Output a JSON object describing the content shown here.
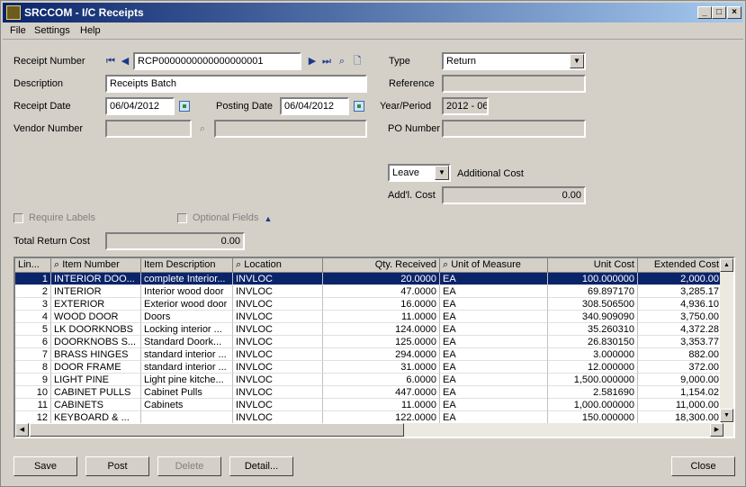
{
  "window": {
    "title": "SRCCOM - I/C Receipts"
  },
  "menu": [
    "File",
    "Settings",
    "Help"
  ],
  "form": {
    "receipt_number_label": "Receipt Number",
    "receipt_number": "RCP0000000000000000001",
    "description_label": "Description",
    "description": "Receipts Batch",
    "receipt_date_label": "Receipt Date",
    "receipt_date": "06/04/2012",
    "posting_date_label": "Posting Date",
    "posting_date": "06/04/2012",
    "vendor_number_label": "Vendor Number",
    "vendor_number": "",
    "vendor_name": "",
    "type_label": "Type",
    "type_value": "Return",
    "reference_label": "Reference",
    "reference": "",
    "year_period_label": "Year/Period",
    "year_period": "2012 - 06",
    "po_number_label": "PO Number",
    "po_number": "",
    "additional_cost_select": "Leave",
    "additional_cost_label": "Additional Cost",
    "addl_cost_label": "Add'l. Cost",
    "addl_cost": "0.00",
    "require_labels": "Require Labels",
    "optional_fields": "Optional Fields",
    "total_return_cost_label": "Total Return Cost",
    "total_return_cost": "0.00"
  },
  "grid": {
    "columns": [
      "Lin...",
      "Item Number",
      "Item Description",
      "Location",
      "Qty. Received",
      "Unit of Measure",
      "Unit Cost",
      "Extended Cost"
    ],
    "rows": [
      [
        "1",
        "INTERIOR DOO...",
        "complete Interior...",
        "INVLOC",
        "20.0000",
        "EA",
        "100.000000",
        "2,000.00"
      ],
      [
        "2",
        "INTERIOR",
        "Interior wood door",
        "INVLOC",
        "47.0000",
        "EA",
        "69.897170",
        "3,285.17"
      ],
      [
        "3",
        "EXTERIOR",
        "Exterior wood door",
        "INVLOC",
        "16.0000",
        "EA",
        "308.506500",
        "4,936.10"
      ],
      [
        "4",
        "WOOD DOOR",
        "Doors",
        "INVLOC",
        "11.0000",
        "EA",
        "340.909090",
        "3,750.00"
      ],
      [
        "5",
        "LK DOORKNOBS",
        "Locking interior ...",
        "INVLOC",
        "124.0000",
        "EA",
        "35.260310",
        "4,372.28"
      ],
      [
        "6",
        "DOORKNOBS S...",
        "Standard Doork...",
        "INVLOC",
        "125.0000",
        "EA",
        "26.830150",
        "3,353.77"
      ],
      [
        "7",
        "BRASS HINGES",
        "standard interior ...",
        "INVLOC",
        "294.0000",
        "EA",
        "3.000000",
        "882.00"
      ],
      [
        "8",
        "DOOR FRAME",
        "standard interior ...",
        "INVLOC",
        "31.0000",
        "EA",
        "12.000000",
        "372.00"
      ],
      [
        "9",
        "LIGHT PINE",
        "Light pine kitche...",
        "INVLOC",
        "6.0000",
        "EA",
        "1,500.000000",
        "9,000.00"
      ],
      [
        "10",
        "CABINET PULLS",
        "Cabinet Pulls",
        "INVLOC",
        "447.0000",
        "EA",
        "2.581690",
        "1,154.02"
      ],
      [
        "11",
        "CABINETS",
        "Cabinets",
        "INVLOC",
        "11.0000",
        "EA",
        "1,000.000000",
        "11,000.00"
      ],
      [
        "12",
        "KEYBOARD & ...",
        "",
        "INVLOC",
        "122.0000",
        "EA",
        "150.000000",
        "18,300.00"
      ]
    ]
  },
  "buttons": {
    "save": "Save",
    "post": "Post",
    "delete": "Delete",
    "detail": "Detail...",
    "close": "Close"
  }
}
